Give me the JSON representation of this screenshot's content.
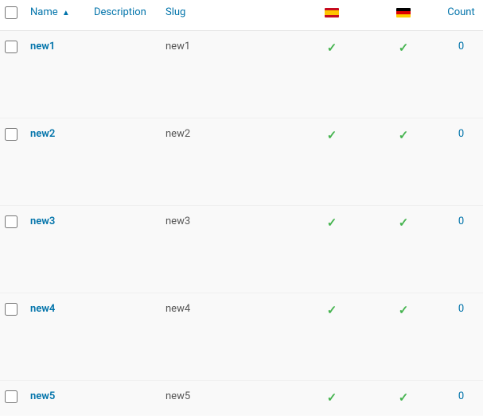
{
  "headers": {
    "name": "Name",
    "description": "Description",
    "slug": "Slug",
    "count": "Count",
    "flag1_country": "Spain",
    "flag2_country": "Germany"
  },
  "sort_indicator": "▲",
  "rows": [
    {
      "name": "new1",
      "description": "",
      "slug": "new1",
      "flag1": "✓",
      "flag2": "✓",
      "count": "0"
    },
    {
      "name": "new2",
      "description": "",
      "slug": "new2",
      "flag1": "✓",
      "flag2": "✓",
      "count": "0"
    },
    {
      "name": "new3",
      "description": "",
      "slug": "new3",
      "flag1": "✓",
      "flag2": "✓",
      "count": "0"
    },
    {
      "name": "new4",
      "description": "",
      "slug": "new4",
      "flag1": "✓",
      "flag2": "✓",
      "count": "0"
    },
    {
      "name": "new5",
      "description": "",
      "slug": "new5",
      "flag1": "✓",
      "flag2": "✓",
      "count": "0"
    }
  ]
}
